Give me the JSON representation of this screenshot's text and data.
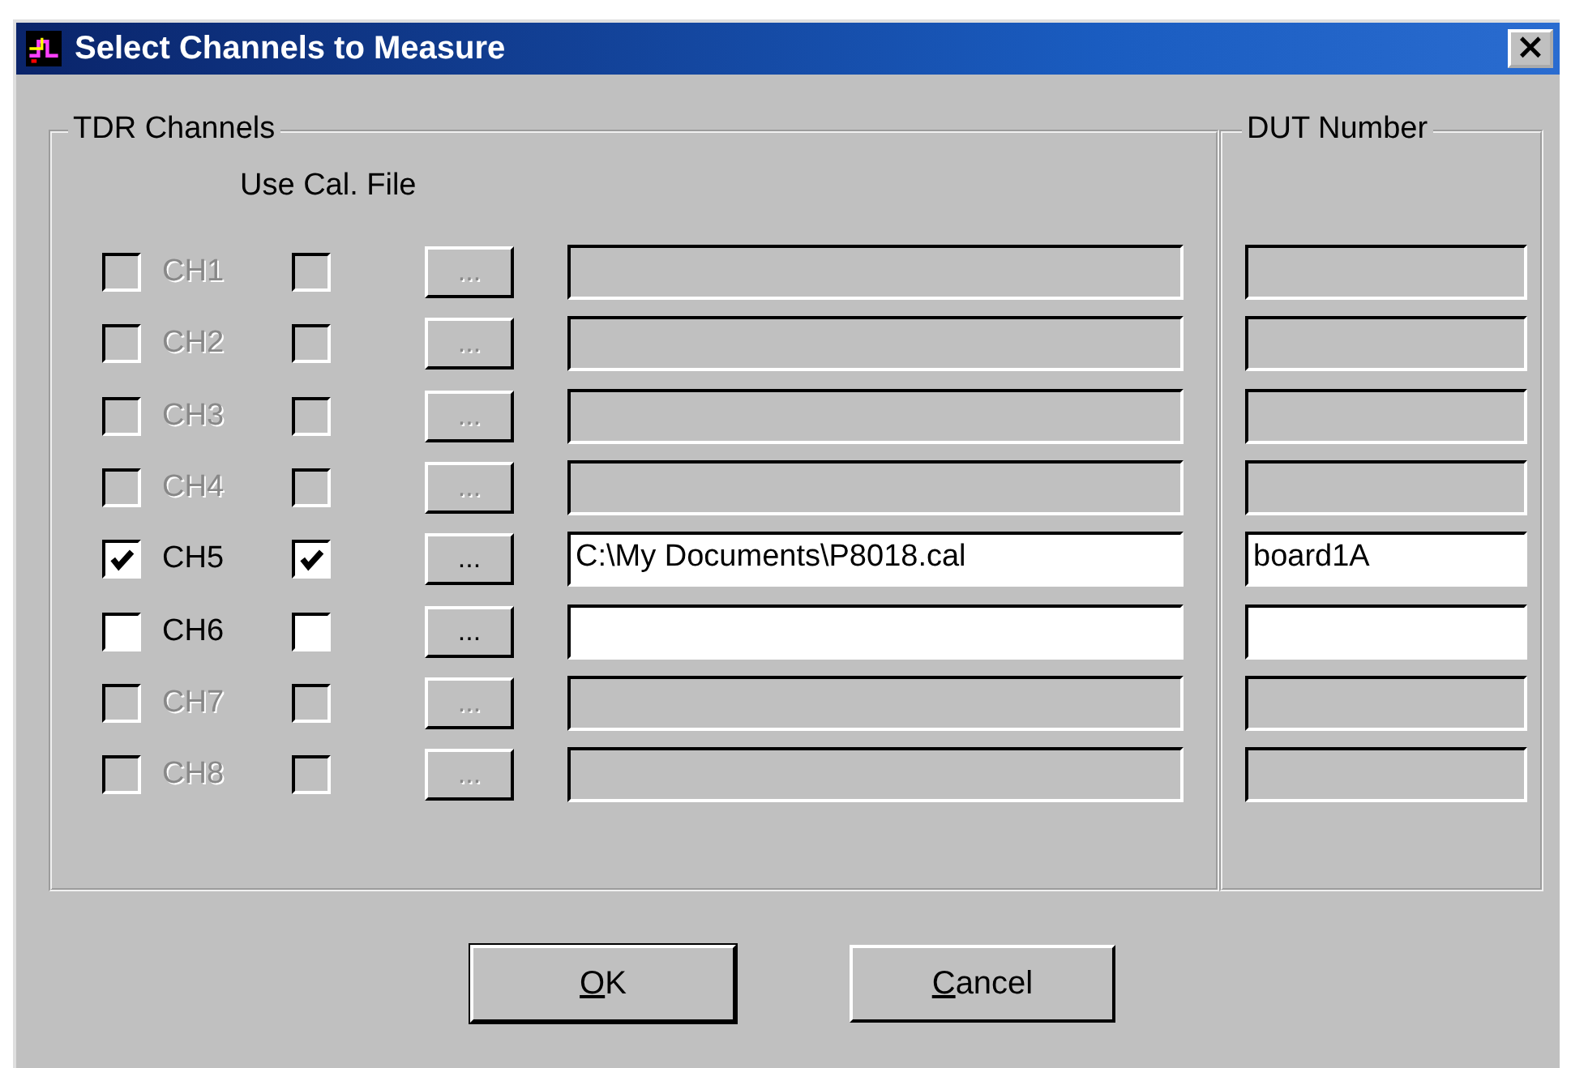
{
  "window": {
    "title": "Select Channels to Measure",
    "close_label": "×"
  },
  "tdr_group": {
    "title": "TDR Channels",
    "cal_header": "Use Cal. File"
  },
  "dut_group": {
    "title": "DUT Number"
  },
  "channels": [
    {
      "label": "CH1",
      "enabled": false,
      "checked": false,
      "use_cal": false,
      "browse_label": "..."
    },
    {
      "label": "CH2",
      "enabled": false,
      "checked": false,
      "use_cal": false,
      "browse_label": "..."
    },
    {
      "label": "CH3",
      "enabled": false,
      "checked": false,
      "use_cal": false,
      "browse_label": "..."
    },
    {
      "label": "CH4",
      "enabled": false,
      "checked": false,
      "use_cal": false,
      "browse_label": "..."
    },
    {
      "label": "CH5",
      "enabled": true,
      "checked": true,
      "use_cal": true,
      "browse_label": "...",
      "cal_file": "C:\\My Documents\\P8018.cal",
      "dut": "board1A"
    },
    {
      "label": "CH6",
      "enabled": true,
      "checked": false,
      "use_cal": false,
      "browse_label": "..."
    },
    {
      "label": "CH7",
      "enabled": false,
      "checked": false,
      "use_cal": false,
      "browse_label": "..."
    },
    {
      "label": "CH8",
      "enabled": false,
      "checked": false,
      "use_cal": false,
      "browse_label": "..."
    }
  ],
  "buttons": [
    {
      "label": "OK",
      "default": true
    },
    {
      "label": "Cancel",
      "default": false
    }
  ]
}
